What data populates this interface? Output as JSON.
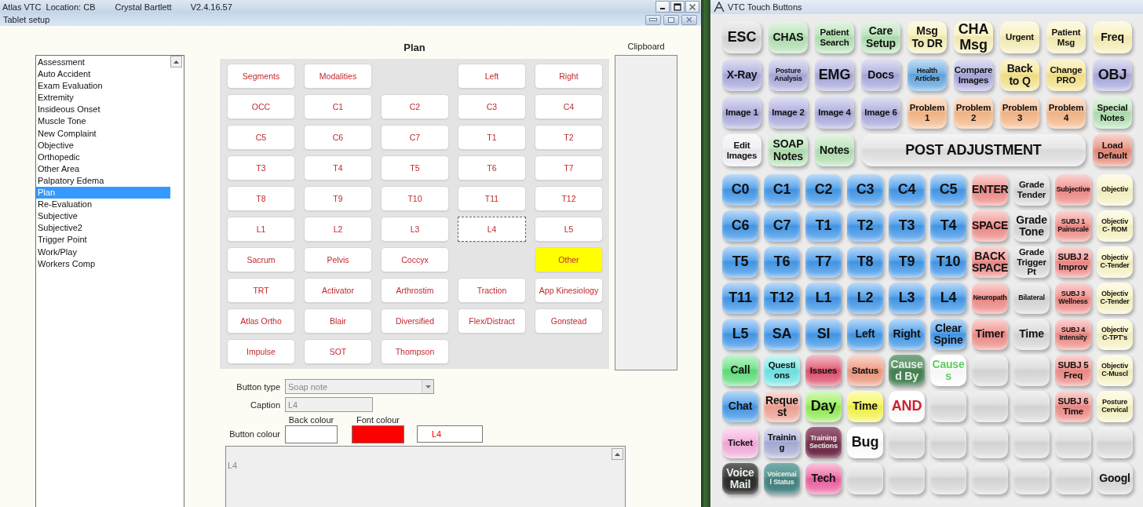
{
  "main_window": {
    "app": "Atlas VTC",
    "location": "Location: CB",
    "user": "Crystal Bartlett",
    "version": "V2.4.16.57",
    "subwindow_title": "Tablet setup"
  },
  "categories": [
    {
      "label": "Assessment",
      "selected": false
    },
    {
      "label": "Auto Accident",
      "selected": false
    },
    {
      "label": "Exam Evaluation",
      "selected": false
    },
    {
      "label": "Extremity",
      "selected": false
    },
    {
      "label": "Insideous Onset",
      "selected": false
    },
    {
      "label": "Muscle Tone",
      "selected": false
    },
    {
      "label": "New Complaint",
      "selected": false
    },
    {
      "label": "Objective",
      "selected": false
    },
    {
      "label": "Orthopedic",
      "selected": false
    },
    {
      "label": "Other Area",
      "selected": false
    },
    {
      "label": "Palpatory Edema",
      "selected": false
    },
    {
      "label": "Plan",
      "selected": true
    },
    {
      "label": "Re-Evaluation",
      "selected": false
    },
    {
      "label": "Subjective",
      "selected": false
    },
    {
      "label": "Subjective2",
      "selected": false
    },
    {
      "label": "Trigger Point",
      "selected": false
    },
    {
      "label": "Work/Play",
      "selected": false
    },
    {
      "label": "Workers Comp",
      "selected": false
    }
  ],
  "plan": {
    "title": "Plan",
    "buttons": [
      {
        "kind": "button",
        "label": "Segments",
        "color": "#ffffff",
        "selected": false
      },
      {
        "kind": "button",
        "label": "Modalities",
        "color": "#ffffff",
        "selected": false
      },
      {
        "kind": "blank"
      },
      {
        "kind": "button",
        "label": "Left",
        "color": "#ffffff",
        "selected": false
      },
      {
        "kind": "button",
        "label": "Right",
        "color": "#ffffff",
        "selected": false
      },
      {
        "kind": "button",
        "label": "OCC",
        "color": "#ffffff",
        "selected": false
      },
      {
        "kind": "button",
        "label": "C1",
        "color": "#ffffff",
        "selected": false
      },
      {
        "kind": "button",
        "label": "C2",
        "color": "#ffffff",
        "selected": false
      },
      {
        "kind": "button",
        "label": "C3",
        "color": "#ffffff",
        "selected": false
      },
      {
        "kind": "button",
        "label": "C4",
        "color": "#ffffff",
        "selected": false
      },
      {
        "kind": "button",
        "label": "C5",
        "color": "#ffffff",
        "selected": false
      },
      {
        "kind": "button",
        "label": "C6",
        "color": "#ffffff",
        "selected": false
      },
      {
        "kind": "button",
        "label": "C7",
        "color": "#ffffff",
        "selected": false
      },
      {
        "kind": "button",
        "label": "T1",
        "color": "#ffffff",
        "selected": false
      },
      {
        "kind": "button",
        "label": "T2",
        "color": "#ffffff",
        "selected": false
      },
      {
        "kind": "button",
        "label": "T3",
        "color": "#ffffff",
        "selected": false
      },
      {
        "kind": "button",
        "label": "T4",
        "color": "#ffffff",
        "selected": false
      },
      {
        "kind": "button",
        "label": "T5",
        "color": "#ffffff",
        "selected": false
      },
      {
        "kind": "button",
        "label": "T6",
        "color": "#ffffff",
        "selected": false
      },
      {
        "kind": "button",
        "label": "T7",
        "color": "#ffffff",
        "selected": false
      },
      {
        "kind": "button",
        "label": "T8",
        "color": "#ffffff",
        "selected": false
      },
      {
        "kind": "button",
        "label": "T9",
        "color": "#ffffff",
        "selected": false
      },
      {
        "kind": "button",
        "label": "T10",
        "color": "#ffffff",
        "selected": false
      },
      {
        "kind": "button",
        "label": "T11",
        "color": "#ffffff",
        "selected": false
      },
      {
        "kind": "button",
        "label": "T12",
        "color": "#ffffff",
        "selected": false
      },
      {
        "kind": "button",
        "label": "L1",
        "color": "#ffffff",
        "selected": false
      },
      {
        "kind": "button",
        "label": "L2",
        "color": "#ffffff",
        "selected": false
      },
      {
        "kind": "button",
        "label": "L3",
        "color": "#ffffff",
        "selected": false
      },
      {
        "kind": "button",
        "label": "L4",
        "color": "#ffffff",
        "selected": true
      },
      {
        "kind": "button",
        "label": "L5",
        "color": "#ffffff",
        "selected": false
      },
      {
        "kind": "button",
        "label": "Sacrum",
        "color": "#ffffff",
        "selected": false
      },
      {
        "kind": "button",
        "label": "Pelvis",
        "color": "#ffffff",
        "selected": false
      },
      {
        "kind": "button",
        "label": "Coccyx",
        "color": "#ffffff",
        "selected": false
      },
      {
        "kind": "blank"
      },
      {
        "kind": "button",
        "label": "Other",
        "color": "#ffff00",
        "selected": false
      },
      {
        "kind": "button",
        "label": "TRT",
        "color": "#ffffff",
        "selected": false
      },
      {
        "kind": "button",
        "label": "Activator",
        "color": "#ffffff",
        "selected": false
      },
      {
        "kind": "button",
        "label": "Arthrostim",
        "color": "#ffffff",
        "selected": false
      },
      {
        "kind": "button",
        "label": "Traction",
        "color": "#ffffff",
        "selected": false
      },
      {
        "kind": "button",
        "label": "App Kinesiology",
        "color": "#ffffff",
        "selected": false
      },
      {
        "kind": "button",
        "label": "Atlas Ortho",
        "color": "#ffffff",
        "selected": false
      },
      {
        "kind": "button",
        "label": "Blair",
        "color": "#ffffff",
        "selected": false
      },
      {
        "kind": "button",
        "label": "Diversified",
        "color": "#ffffff",
        "selected": false
      },
      {
        "kind": "button",
        "label": "Flex/Distract",
        "color": "#ffffff",
        "selected": false
      },
      {
        "kind": "button",
        "label": "Gonstead",
        "color": "#ffffff",
        "selected": false
      },
      {
        "kind": "button",
        "label": "Impulse",
        "color": "#ffffff",
        "selected": false
      },
      {
        "kind": "button",
        "label": "SOT",
        "color": "#ffffff",
        "selected": false
      },
      {
        "kind": "button",
        "label": "Thompson",
        "color": "#ffffff",
        "selected": false
      }
    ]
  },
  "clipboard": {
    "title": "Clipboard"
  },
  "editor": {
    "button_type_label": "Button type",
    "button_type": {
      "value": "Soap note",
      "disabled": true
    },
    "caption_label": "Caption",
    "caption": {
      "value": "L4",
      "disabled": true
    },
    "button_colour_label": "Button colour",
    "back_colour": {
      "label": "Back colour",
      "color": "#ffffff"
    },
    "font_colour": {
      "label": "Font colour",
      "color": "#ff0000"
    },
    "preview": "L4",
    "note": "L4"
  },
  "touch_window": {
    "title": "VTC Touch Buttons",
    "top_buttons": [
      {
        "kind": "button",
        "label": "ESC",
        "color": "#d6d6d6"
      },
      {
        "kind": "button",
        "label": "CHAS",
        "color": "#b3e2b3"
      },
      {
        "kind": "button",
        "label": "Patient\nSearch",
        "color": "#b3e2b3"
      },
      {
        "kind": "button",
        "label": "Care\nSetup",
        "color": "#b3e2b3"
      },
      {
        "kind": "button",
        "label": "Msg\nTo DR",
        "color": "#f8f0b8"
      },
      {
        "kind": "button",
        "label": "CHA\nMsg",
        "color": "#f8f0b8"
      },
      {
        "kind": "button",
        "label": "Urgent",
        "color": "#f8f0b8"
      },
      {
        "kind": "button",
        "label": "Patient\nMsg",
        "color": "#f8f0b8"
      },
      {
        "kind": "button",
        "label": "Freq",
        "color": "#f8f0b8"
      },
      {
        "kind": "button",
        "label": "X-Ray",
        "color": "#aaaade"
      },
      {
        "kind": "button",
        "label": "Posture\nAnalysis",
        "color": "#aaaade"
      },
      {
        "kind": "button",
        "label": "EMG",
        "color": "#aaaade"
      },
      {
        "kind": "button",
        "label": "Docs",
        "color": "#aaaade"
      },
      {
        "kind": "button",
        "label": "Health\nArticles",
        "color": "#62a8e2"
      },
      {
        "kind": "button",
        "label": "Compare\nImages",
        "color": "#aaaade"
      },
      {
        "kind": "button",
        "label": "Back\nto Q",
        "color": "#f6e48a"
      },
      {
        "kind": "button",
        "label": "Change\nPRO",
        "color": "#f6e48a"
      },
      {
        "kind": "button",
        "label": "OBJ",
        "color": "#aaaade"
      },
      {
        "kind": "button",
        "label": "Image 1",
        "color": "#aaaade"
      },
      {
        "kind": "button",
        "label": "Image 2",
        "color": "#aaaade"
      },
      {
        "kind": "button",
        "label": "Image 4",
        "color": "#aaaade"
      },
      {
        "kind": "button",
        "label": "Image 6",
        "color": "#aaaade"
      },
      {
        "kind": "button",
        "label": "Problem\n1",
        "color": "#f7b98a"
      },
      {
        "kind": "button",
        "label": "Problem\n2",
        "color": "#f7b98a"
      },
      {
        "kind": "button",
        "label": "Problem\n3",
        "color": "#f7b98a"
      },
      {
        "kind": "button",
        "label": "Problem\n4",
        "color": "#f7b98a"
      },
      {
        "kind": "button",
        "label": "Special\nNotes",
        "color": "#b3e2b3"
      },
      {
        "kind": "button",
        "label": "Edit\nImages",
        "color": "#eeeef4"
      },
      {
        "kind": "button",
        "label": "SOAP\nNotes",
        "color": "#b3e2b3"
      },
      {
        "kind": "button",
        "label": "Notes",
        "color": "#b3e2b3"
      },
      {
        "kind": "wide",
        "label": "POST ADJUSTMENT",
        "color": "#e2e2e2"
      },
      {
        "kind": "button",
        "label": "Load\nDefault",
        "color": "#ea8a78"
      }
    ],
    "grid_buttons": [
      {
        "kind": "button",
        "label": "C0",
        "color": "#4499ea"
      },
      {
        "kind": "button",
        "label": "C1",
        "color": "#4499ea"
      },
      {
        "kind": "button",
        "label": "C2",
        "color": "#4499ea"
      },
      {
        "kind": "button",
        "label": "C3",
        "color": "#4499ea"
      },
      {
        "kind": "button",
        "label": "C4",
        "color": "#4499ea"
      },
      {
        "kind": "button",
        "label": "C5",
        "color": "#4499ea"
      },
      {
        "kind": "button",
        "label": "ENTER",
        "color": "#f08c88"
      },
      {
        "kind": "button",
        "label": "Grade\nTender",
        "color": "#d8d8d8"
      },
      {
        "kind": "button",
        "label": "Subjective",
        "color": "#f08c88"
      },
      {
        "kind": "button",
        "label": "Objectiv",
        "color": "#f8f4c4"
      },
      {
        "kind": "button",
        "label": "C6",
        "color": "#4499ea"
      },
      {
        "kind": "button",
        "label": "C7",
        "color": "#4499ea"
      },
      {
        "kind": "button",
        "label": "T1",
        "color": "#4499ea"
      },
      {
        "kind": "button",
        "label": "T2",
        "color": "#4499ea"
      },
      {
        "kind": "button",
        "label": "T3",
        "color": "#4499ea"
      },
      {
        "kind": "button",
        "label": "T4",
        "color": "#4499ea"
      },
      {
        "kind": "button",
        "label": "SPACE",
        "color": "#f08c88"
      },
      {
        "kind": "button",
        "label": "Grade\nTone",
        "color": "#d8d8d8"
      },
      {
        "kind": "button",
        "label": "SUBJ 1\nPainscale",
        "color": "#f08c88"
      },
      {
        "kind": "button",
        "label": "Objectiv\nC- ROM",
        "color": "#f8f4c4"
      },
      {
        "kind": "button",
        "label": "T5",
        "color": "#4499ea"
      },
      {
        "kind": "button",
        "label": "T6",
        "color": "#4499ea"
      },
      {
        "kind": "button",
        "label": "T7",
        "color": "#4499ea"
      },
      {
        "kind": "button",
        "label": "T8",
        "color": "#4499ea"
      },
      {
        "kind": "button",
        "label": "T9",
        "color": "#4499ea"
      },
      {
        "kind": "button",
        "label": "T10",
        "color": "#4499ea"
      },
      {
        "kind": "button",
        "label": "BACK\nSPACE",
        "color": "#f08c88"
      },
      {
        "kind": "button",
        "label": "Grade\nTrigger\nPt",
        "color": "#d8d8d8"
      },
      {
        "kind": "button",
        "label": "SUBJ 2\nImprov",
        "color": "#f08c88"
      },
      {
        "kind": "button",
        "label": "Objectiv\nC-Tender",
        "color": "#f8f4c4"
      },
      {
        "kind": "button",
        "label": "T11",
        "color": "#4499ea"
      },
      {
        "kind": "button",
        "label": "T12",
        "color": "#4499ea"
      },
      {
        "kind": "button",
        "label": "L1",
        "color": "#4499ea"
      },
      {
        "kind": "button",
        "label": "L2",
        "color": "#4499ea"
      },
      {
        "kind": "button",
        "label": "L3",
        "color": "#4499ea"
      },
      {
        "kind": "button",
        "label": "L4",
        "color": "#4499ea"
      },
      {
        "kind": "button",
        "label": "Neuropath",
        "color": "#f08c88"
      },
      {
        "kind": "button",
        "label": "Bilateral",
        "color": "#d8d8d8"
      },
      {
        "kind": "button",
        "label": "SUBJ 3\nWellness",
        "color": "#f08c88"
      },
      {
        "kind": "button",
        "label": "Objectiv\nC-Tender",
        "color": "#f8f4c4"
      },
      {
        "kind": "button",
        "label": "L5",
        "color": "#4499ea"
      },
      {
        "kind": "button",
        "label": "SA",
        "color": "#4499ea"
      },
      {
        "kind": "button",
        "label": "SI",
        "color": "#4499ea"
      },
      {
        "kind": "button",
        "label": "Left",
        "color": "#4499ea"
      },
      {
        "kind": "button",
        "label": "Right",
        "color": "#4499ea"
      },
      {
        "kind": "button",
        "label": "Clear\nSpine",
        "color": "#4499ea"
      },
      {
        "kind": "button",
        "label": "Timer",
        "color": "#f08c88"
      },
      {
        "kind": "button",
        "label": "Time",
        "color": "#d8d8d8"
      },
      {
        "kind": "button",
        "label": "SUBJ 4\nIntensity",
        "color": "#f08c88"
      },
      {
        "kind": "button",
        "label": "Objectiv\nC-TPT's",
        "color": "#f8f4c4"
      },
      {
        "kind": "button",
        "label": "Call",
        "color": "#5fe07c"
      },
      {
        "kind": "button",
        "label": "Questi\nons",
        "color": "#70e6e6"
      },
      {
        "kind": "button",
        "label": "Issues",
        "color": "#e0506c"
      },
      {
        "kind": "button",
        "label": "Status",
        "color": "#f0967c"
      },
      {
        "kind": "dark",
        "label": "Cause\nd By",
        "color": "#4e8c5c"
      },
      {
        "kind": "button",
        "label": "Cause\ns",
        "color": "#ffffff",
        "font": {
          "color": "#5ccc5c"
        }
      },
      {
        "kind": "blank",
        "color": "#dadada"
      },
      {
        "kind": "blank",
        "color": "#dadada"
      },
      {
        "kind": "button",
        "label": "SUBJ 5\nFreq",
        "color": "#f08c88"
      },
      {
        "kind": "button",
        "label": "Objectiv\nC-Muscl",
        "color": "#f8f4c4"
      },
      {
        "kind": "button",
        "label": "Chat",
        "color": "#4499ea"
      },
      {
        "kind": "button",
        "label": "Reque\nst",
        "color": "#f2a496"
      },
      {
        "kind": "button",
        "label": "Day",
        "color": "#92ee52"
      },
      {
        "kind": "button",
        "label": "Time",
        "color": "#f6f64c"
      },
      {
        "kind": "button",
        "label": "AND",
        "color": "#ffffff",
        "font": {
          "color": "#d02030"
        }
      },
      {
        "kind": "blank",
        "color": "#dadada"
      },
      {
        "kind": "blank",
        "color": "#dadada"
      },
      {
        "kind": "blank",
        "color": "#dadada"
      },
      {
        "kind": "button",
        "label": "SUBJ 6\nTime",
        "color": "#f08c88"
      },
      {
        "kind": "button",
        "label": "Posture\nCervical",
        "color": "#f8f4c4"
      },
      {
        "kind": "button",
        "label": "Ticket",
        "color": "#f4aadc"
      },
      {
        "kind": "button",
        "label": "Trainin\ng",
        "color": "#a8aed8"
      },
      {
        "kind": "dark",
        "label": "Training\nSections",
        "color": "#7a3050"
      },
      {
        "kind": "button",
        "label": "Bug",
        "color": "#ffffff"
      },
      {
        "kind": "blank",
        "color": "#dadada"
      },
      {
        "kind": "blank",
        "color": "#dadada"
      },
      {
        "kind": "blank",
        "color": "#dadada"
      },
      {
        "kind": "blank",
        "color": "#dadada"
      },
      {
        "kind": "blank",
        "color": "#dadada"
      },
      {
        "kind": "blank",
        "color": "#dadada"
      },
      {
        "kind": "dark",
        "label": "Voice\nMail",
        "color": "#333333"
      },
      {
        "kind": "dark",
        "label": "Voicemai\nl Status",
        "color": "#4e8e8e"
      },
      {
        "kind": "button",
        "label": "Tech",
        "color": "#ee60a0"
      },
      {
        "kind": "blank",
        "color": "#dadada"
      },
      {
        "kind": "blank",
        "color": "#dadada"
      },
      {
        "kind": "blank",
        "color": "#dadada"
      },
      {
        "kind": "blank",
        "color": "#dadada"
      },
      {
        "kind": "blank",
        "color": "#dadada"
      },
      {
        "kind": "blank",
        "color": "#dadada"
      },
      {
        "kind": "button",
        "label": "Googl",
        "color": "#dadada"
      }
    ]
  }
}
